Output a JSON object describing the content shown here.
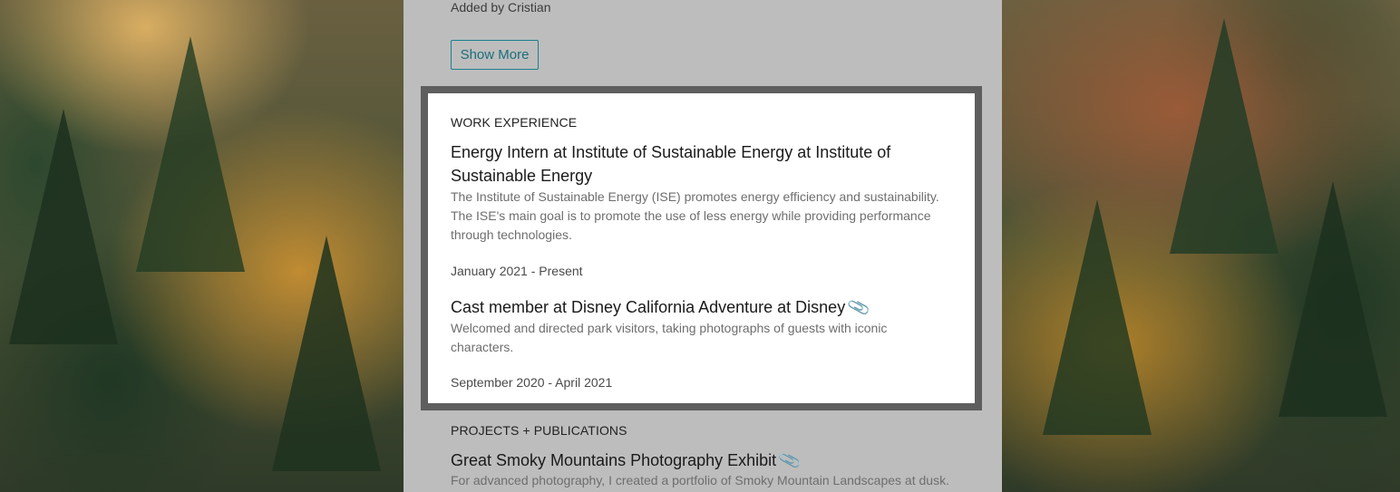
{
  "profile": {
    "added_by": "Added by Cristian",
    "show_more_label": "Show More"
  },
  "work_experience": {
    "heading": "WORK EXPERIENCE",
    "jobs": [
      {
        "title": "Energy Intern at Institute of Sustainable Energy at Institute of Sustainable Energy",
        "description": "The Institute of Sustainable Energy (ISE) promotes energy efficiency and sustainability. The ISE's main goal is to promote the use of less energy while providing performance through technologies.",
        "dates": "January 2021 - Present",
        "has_attachment": false
      },
      {
        "title": "Cast member at Disney California Adventure at Disney",
        "description": "Welcomed and directed park visitors, taking photographs of guests with iconic characters.",
        "dates": "September 2020 - April 2021",
        "has_attachment": true
      }
    ]
  },
  "projects": {
    "heading": "PROJECTS + PUBLICATIONS",
    "items": [
      {
        "title": "Great Smoky Mountains Photography Exhibit",
        "description": "For advanced photography, I created a portfolio of Smoky Mountain Landscapes at dusk.",
        "has_attachment": true
      }
    ]
  },
  "colors": {
    "panel_bg": "#bdbdbd",
    "accent": "#1a7f8c",
    "attachment_icon": "#1aa0b0"
  },
  "icons": {
    "attachment": "paperclip-icon"
  }
}
